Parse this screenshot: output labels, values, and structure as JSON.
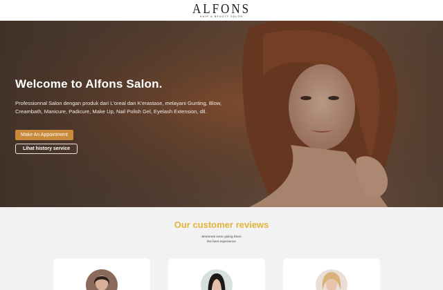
{
  "header": {
    "logo_word": "ALFONS",
    "logo_tagline": "hair & beauty salon"
  },
  "hero": {
    "title": "Welcome to Alfons Salon.",
    "description": "Professionnal Salon dengan produk dari L'oreal dan K'erastase, melayani Gunting, Blow, Creambath, Manicure, Padicure, Make Up, Nail Polish Gel, Eyelash Extension, dll.",
    "primary_button": "Make An Appointment",
    "secondary_button": "Lihat history service"
  },
  "reviews": {
    "title": "Our customer reviews",
    "subtitle_line1": "Moments were giving them",
    "subtitle_line2": "the best experience"
  },
  "colors": {
    "accent": "#c98a3c",
    "reviews_title": "#e0b43a"
  }
}
